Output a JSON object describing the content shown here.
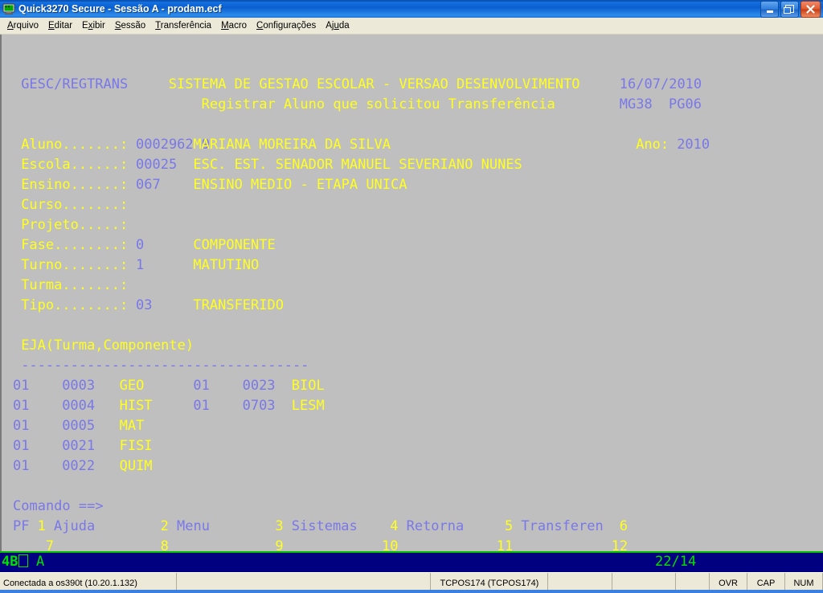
{
  "window": {
    "title": "Quick3270 Secure - Sessão A - prodam.ecf",
    "icon": "terminal-monitor-icon",
    "buttons": {
      "minimize": "minimize-icon",
      "maximize": "restore-icon",
      "close": "close-icon"
    }
  },
  "menubar": {
    "items": [
      {
        "label": "Arquivo",
        "accel": "A"
      },
      {
        "label": "Editar",
        "accel": "E"
      },
      {
        "label": "Exibir",
        "accel": "x"
      },
      {
        "label": "Sessão",
        "accel": "S"
      },
      {
        "label": "Transferência",
        "accel": "T"
      },
      {
        "label": "Macro",
        "accel": "M"
      },
      {
        "label": "Configurações",
        "accel": "C"
      },
      {
        "label": "Ajuda",
        "accel": "u"
      }
    ]
  },
  "colors": {
    "terminal_background": "#bfbfbf",
    "protected_blue": "#7a78e8",
    "input_yellow": "#ffff20",
    "oia_background": "#000080",
    "oia_text": "#00e000",
    "titlebar_blue": "#0a5fd0"
  },
  "terminal": {
    "header": {
      "transaction": "GESC/REGTRANS",
      "system_title": "SISTEMA DE GESTAO ESCOLAR - VERSAO DESENVOLVIMENTO",
      "date": "16/07/2010",
      "subtitle": "Registrar Aluno que solicitou Transferência",
      "terminal_id": "MG38",
      "page_id": "PG06"
    },
    "fields": [
      {
        "label": "Aluno.......:",
        "code": "0002962 9",
        "description": "MARIANA MOREIRA DA SILVA"
      },
      {
        "label": "Escola......:",
        "code": "00025",
        "description": "ESC. EST. SENADOR MANUEL SEVERIANO NUNES"
      },
      {
        "label": "Ensino......:",
        "code": "067",
        "description": "ENSINO MEDIO - ETAPA UNICA"
      },
      {
        "label": "Curso.......:",
        "code": "",
        "description": ""
      },
      {
        "label": "Projeto.....:",
        "code": "",
        "description": ""
      },
      {
        "label": "Fase........:",
        "code": "0",
        "description": "COMPONENTE"
      },
      {
        "label": "Turno.......:",
        "code": "1",
        "description": "MATUTINO"
      },
      {
        "label": "Turma.......:",
        "code": "",
        "description": ""
      },
      {
        "label": "Tipo........:",
        "code": "03",
        "description": "TRANSFERIDO"
      }
    ],
    "year_label": "Ano:",
    "year_value": "2010",
    "eja": {
      "title": "EJA(Turma,Componente)",
      "separator": "-----------------------------------",
      "rows": [
        {
          "turma_a": "01",
          "code_a": "0003",
          "comp_a": "GEO",
          "turma_b": "01",
          "code_b": "0023",
          "comp_b": "BIOL"
        },
        {
          "turma_a": "01",
          "code_a": "0004",
          "comp_a": "HIST",
          "turma_b": "01",
          "code_b": "0703",
          "comp_b": "LESM"
        },
        {
          "turma_a": "01",
          "code_a": "0005",
          "comp_a": "MAT",
          "turma_b": "",
          "code_b": "",
          "comp_b": ""
        },
        {
          "turma_a": "01",
          "code_a": "0021",
          "comp_a": "FISI",
          "turma_b": "",
          "code_b": "",
          "comp_b": ""
        },
        {
          "turma_a": "01",
          "code_a": "0022",
          "comp_a": "QUIM",
          "turma_b": "",
          "code_b": "",
          "comp_b": ""
        }
      ]
    },
    "command_prompt": "Comando ==>",
    "command_value": "",
    "pf": {
      "prefix": "PF",
      "row1": [
        {
          "key": "1",
          "label": "Ajuda"
        },
        {
          "key": "2",
          "label": "Menu"
        },
        {
          "key": "3",
          "label": "Sistemas"
        },
        {
          "key": "4",
          "label": "Retorna"
        },
        {
          "key": "5",
          "label": "Transferen"
        },
        {
          "key": "6",
          "label": ""
        }
      ],
      "row2": [
        {
          "key": "7",
          "label": ""
        },
        {
          "key": "8",
          "label": ""
        },
        {
          "key": "9",
          "label": ""
        },
        {
          "key": "10",
          "label": ""
        },
        {
          "key": "11",
          "label": ""
        },
        {
          "key": "12",
          "label": ""
        }
      ]
    }
  },
  "oia": {
    "mode": "4B",
    "box_symbol": "□",
    "session": "A",
    "cursor_position": "22/14"
  },
  "statusbar": {
    "connection": "Conectada a os390t (10.20.1.132)",
    "tcp": "TCPOS174 (TCPOS174)",
    "indicators": [
      "OVR",
      "CAP",
      "NUM"
    ]
  }
}
